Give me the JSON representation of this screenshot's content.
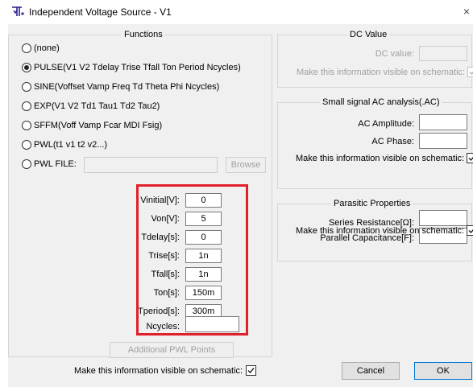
{
  "window": {
    "title": "Independent Voltage Source - V1",
    "close_glyph": "×"
  },
  "functions": {
    "title": "Functions",
    "options": [
      {
        "label": "(none)",
        "checked": false
      },
      {
        "label": "PULSE(V1 V2 Tdelay Trise Tfall Ton Period Ncycles)",
        "checked": true
      },
      {
        "label": "SINE(Voffset Vamp Freq Td Theta Phi Ncycles)",
        "checked": false
      },
      {
        "label": "EXP(V1 V2 Td1 Tau1 Td2 Tau2)",
        "checked": false
      },
      {
        "label": "SFFM(Voff Vamp Fcar MDI Fsig)",
        "checked": false
      },
      {
        "label": "PWL(t1 v1 t2 v2...)",
        "checked": false
      },
      {
        "label": "PWL FILE:",
        "checked": false
      }
    ],
    "pwl_file_value": "",
    "browse_label": "Browse",
    "params": [
      {
        "label": "Vinitial[V]:",
        "value": "0"
      },
      {
        "label": "Von[V]:",
        "value": "5"
      },
      {
        "label": "Tdelay[s]:",
        "value": "0"
      },
      {
        "label": "Trise[s]:",
        "value": "1n"
      },
      {
        "label": "Tfall[s]:",
        "value": "1n"
      },
      {
        "label": "Ton[s]:",
        "value": "150m"
      },
      {
        "label": "Tperiod[s]:",
        "value": "300m"
      },
      {
        "label": "Ncycles:",
        "value": ""
      }
    ],
    "additional_pwl_label": "Additional PWL Points",
    "visible_label": "Make this information visible on schematic:",
    "visible_checked": true
  },
  "dc_value": {
    "title": "DC Value",
    "label": "DC value:",
    "value": "",
    "visible_label": "Make this information visible on schematic:",
    "visible_checked": true
  },
  "ac_analysis": {
    "title": "Small signal AC analysis(.AC)",
    "amplitude_label": "AC Amplitude:",
    "amplitude_value": "",
    "phase_label": "AC Phase:",
    "phase_value": "",
    "visible_label": "Make this information visible on schematic:",
    "visible_checked": true
  },
  "parasitic": {
    "title": "Parasitic Properties",
    "series_label": "Series Resistance[Ω]:",
    "series_value": "",
    "parallel_label": "Parallel Capacitance[F]:",
    "parallel_value": "",
    "visible_label": "Make this information visible on schematic:",
    "visible_checked": true
  },
  "buttons": {
    "cancel": "Cancel",
    "ok": "OK"
  },
  "colors": {
    "highlight": "#e0202a",
    "dialog_bg": "#f0f0f0"
  }
}
